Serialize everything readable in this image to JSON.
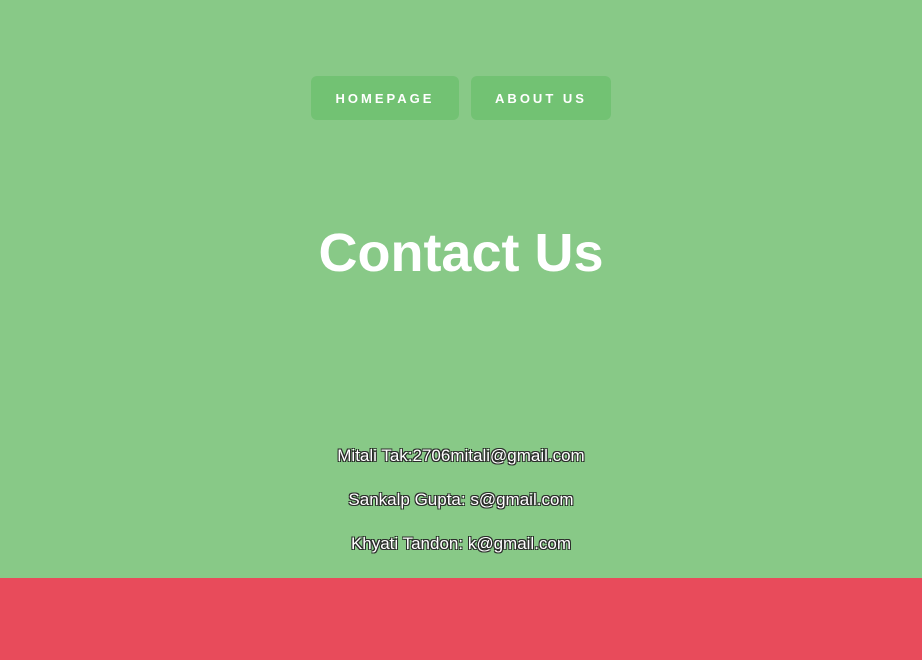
{
  "nav": {
    "items": [
      {
        "label": "HOMEPAGE"
      },
      {
        "label": "ABOUT US"
      }
    ]
  },
  "main": {
    "title": "Contact Us",
    "contacts": [
      "Mitali Tak:2706mitali@gmail.com",
      "Sankalp Gupta: s@gmail.com",
      "Khyati Tandon: k@gmail.com"
    ]
  },
  "colors": {
    "background": "#88c987",
    "nav_button": "#72c273",
    "footer": "#e84b5b",
    "text": "#ffffff"
  }
}
